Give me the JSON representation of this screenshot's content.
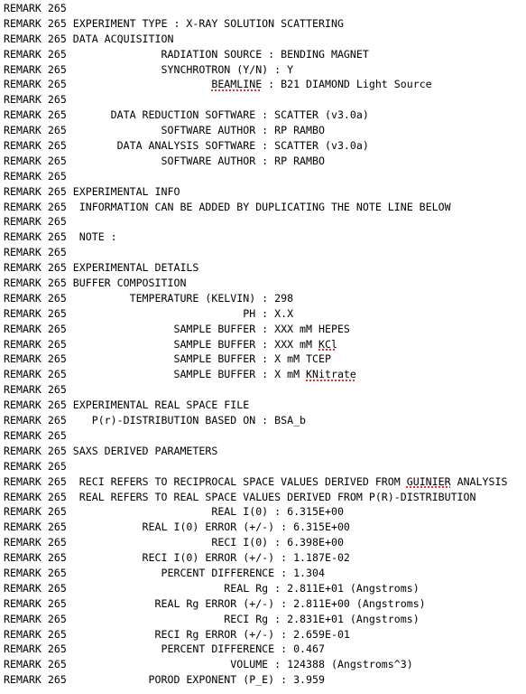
{
  "document": {
    "lines": [
      {
        "text": "REMARK 265"
      },
      {
        "text": "REMARK 265 EXPERIMENT TYPE : X-RAY SOLUTION SCATTERING"
      },
      {
        "text": "REMARK 265 DATA ACQUISITION"
      },
      {
        "text": "REMARK 265               RADIATION SOURCE : BENDING MAGNET"
      },
      {
        "text": "REMARK 265               SYNCHROTRON (Y/N) : Y"
      },
      {
        "pre": "REMARK 265                       ",
        "mark": "BEAMLINE",
        "post": " : B21 DIAMOND Light Source"
      },
      {
        "text": "REMARK 265"
      },
      {
        "text": "REMARK 265       DATA REDUCTION SOFTWARE : SCATTER (v3.0a)"
      },
      {
        "text": "REMARK 265               SOFTWARE AUTHOR : RP RAMBO"
      },
      {
        "text": "REMARK 265        DATA ANALYSIS SOFTWARE : SCATTER (v3.0a)"
      },
      {
        "text": "REMARK 265               SOFTWARE AUTHOR : RP RAMBO"
      },
      {
        "text": "REMARK 265"
      },
      {
        "text": "REMARK 265 EXPERIMENTAL INFO"
      },
      {
        "text": "REMARK 265  INFORMATION CAN BE ADDED BY DUPLICATING THE NOTE LINE BELOW"
      },
      {
        "text": "REMARK 265"
      },
      {
        "text": "REMARK 265  NOTE :"
      },
      {
        "text": "REMARK 265"
      },
      {
        "text": "REMARK 265 EXPERIMENTAL DETAILS"
      },
      {
        "text": "REMARK 265 BUFFER COMPOSITION"
      },
      {
        "text": "REMARK 265          TEMPERATURE (KELVIN) : 298"
      },
      {
        "text": "REMARK 265                            PH : X.X"
      },
      {
        "text": "REMARK 265                 SAMPLE BUFFER : XXX mM HEPES"
      },
      {
        "pre": "REMARK 265                 SAMPLE BUFFER : XXX mM ",
        "mark": "KCl",
        "post": ""
      },
      {
        "text": "REMARK 265                 SAMPLE BUFFER : X mM TCEP"
      },
      {
        "pre": "REMARK 265                 SAMPLE BUFFER : X mM ",
        "mark": "KNitrate",
        "post": ""
      },
      {
        "text": "REMARK 265"
      },
      {
        "text": "REMARK 265 EXPERIMENTAL REAL SPACE FILE"
      },
      {
        "text": "REMARK 265    P(r)-DISTRIBUTION BASED ON : BSA_b"
      },
      {
        "text": "REMARK 265"
      },
      {
        "text": "REMARK 265 SAXS DERIVED PARAMETERS"
      },
      {
        "text": "REMARK 265"
      },
      {
        "pre": "REMARK 265  RECI REFERS TO RECIPROCAL SPACE VALUES DERIVED FROM ",
        "mark": "GUINIER",
        "post": " ANALYSIS"
      },
      {
        "text": "REMARK 265  REAL REFERS TO REAL SPACE VALUES DERIVED FROM P(R)-DISTRIBUTION"
      },
      {
        "text": "REMARK 265                       REAL I(0) : 6.315E+00"
      },
      {
        "text": "REMARK 265            REAL I(0) ERROR (+/-) : 6.315E+00"
      },
      {
        "text": "REMARK 265                       RECI I(0) : 6.398E+00"
      },
      {
        "text": "REMARK 265            RECI I(0) ERROR (+/-) : 1.187E-02"
      },
      {
        "text": "REMARK 265               PERCENT DIFFERENCE : 1.304"
      },
      {
        "text": "REMARK 265                         REAL Rg : 2.811E+01 (Angstroms)"
      },
      {
        "text": "REMARK 265              REAL Rg ERROR (+/-) : 2.811E+00 (Angstroms)"
      },
      {
        "text": "REMARK 265                         RECI Rg : 2.831E+01 (Angstroms)"
      },
      {
        "text": "REMARK 265              RECI Rg ERROR (+/-) : 2.659E-01"
      },
      {
        "text": "REMARK 265               PERCENT DIFFERENCE : 0.467"
      },
      {
        "text": "REMARK 265                          VOLUME : 124388 (Angstroms^3)"
      },
      {
        "text": "REMARK 265             POROD EXPONENT (P_E) : 3.959"
      }
    ]
  }
}
